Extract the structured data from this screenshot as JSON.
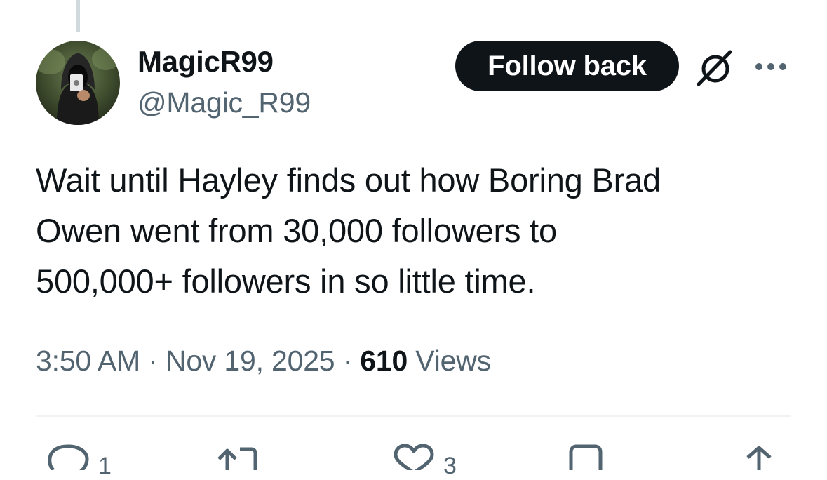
{
  "tweet": {
    "author": {
      "display_name": "MagicR99",
      "handle": "@Magic_R99",
      "avatar_icon": "hooded-figure-holding-card-avatar"
    },
    "follow_button_label": "Follow back",
    "text": "Wait until Hayley finds out how Boring Brad\nOwen went from 30,000 followers to\n500,000+ followers in so little time.",
    "time": "3:50 AM",
    "date": "Nov 19, 2025",
    "separator": "·",
    "views_count": "610",
    "views_label": "Views"
  },
  "actions": {
    "reply_count": "1",
    "retweet_count": "",
    "like_count": "3",
    "bookmark_count": "",
    "icons": [
      "reply-icon",
      "retweet-icon",
      "like-icon",
      "bookmark-icon",
      "share-icon"
    ]
  },
  "colors": {
    "text_primary": "#0f1419",
    "text_secondary": "#536471",
    "button_bg": "#0f1419",
    "divider": "#eff3f4",
    "thread_line": "#cfd9de"
  }
}
